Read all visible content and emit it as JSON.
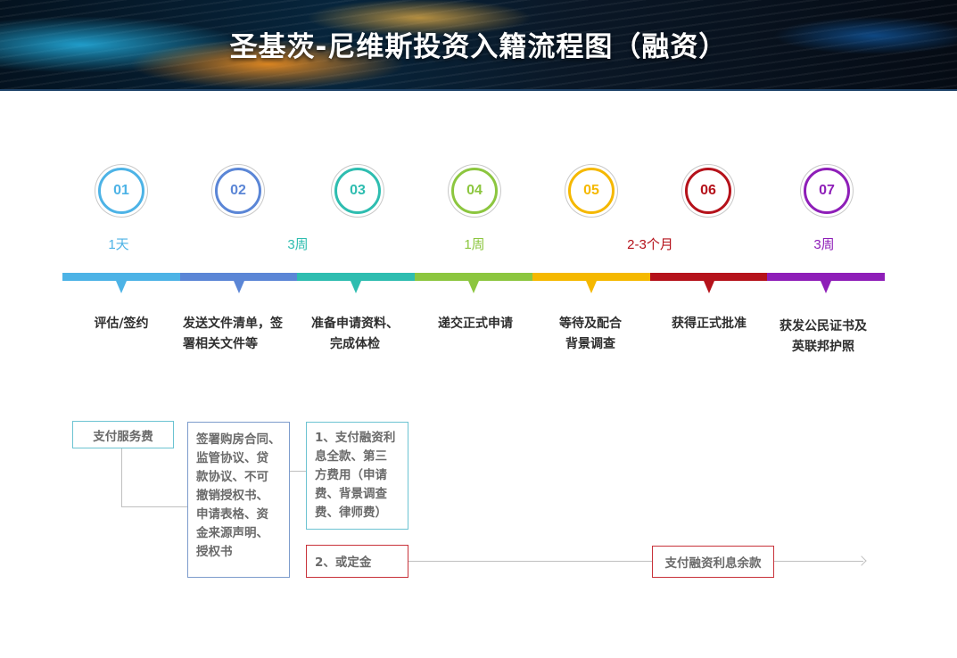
{
  "header": {
    "title": "圣基茨-尼维斯投资入籍流程图（融资）"
  },
  "steps": [
    {
      "number": "01",
      "color": "#4db3e6",
      "duration": "1天",
      "label": "评估/签约"
    },
    {
      "number": "02",
      "color": "#5b86d6",
      "duration": "",
      "label": "发送文件清单，签\n署相关文件等"
    },
    {
      "number": "03",
      "color": "#2ebdb0",
      "duration": "3周",
      "label": "准备申请资料、\n完成体检"
    },
    {
      "number": "04",
      "color": "#8cc63f",
      "duration": "1周",
      "label": "递交正式申请"
    },
    {
      "number": "05",
      "color": "#f5b800",
      "duration": "",
      "label": "等待及配合\n背景调查"
    },
    {
      "number": "06",
      "color": "#b5121b",
      "duration": "2-3个月",
      "label": "获得正式批准"
    },
    {
      "number": "07",
      "color": "#8e1eb8",
      "duration": "3周",
      "label": "获发公民证书及\n英联邦护照"
    }
  ],
  "notes": {
    "pay_service_fee": "支付服务费",
    "sign_documents": "签署购房合同、\n监管协议、贷\n款协议、不可\n撤销授权书、\n申请表格、资\n金来源声明、\n授权书",
    "pay_financing": "1、支付融资利\n息全款、第三\n方费用（申请\n费、背景调查\n费、律师费）",
    "or_deposit": "2、或定金",
    "pay_balance": "支付融资利息余款"
  }
}
